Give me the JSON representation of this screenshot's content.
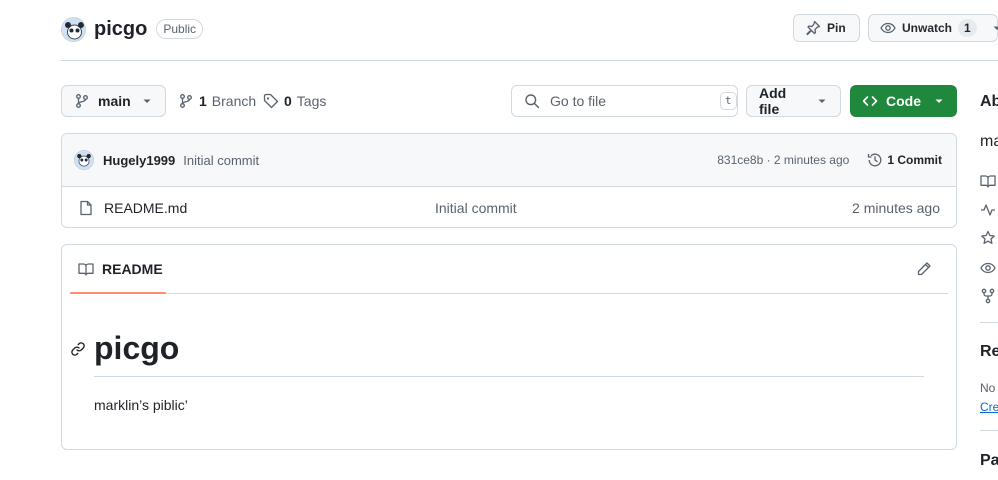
{
  "repo": {
    "name": "picgo",
    "visibility": "Public"
  },
  "header_actions": {
    "pin_label": "Pin",
    "unwatch_label": "Unwatch",
    "watch_count": "1"
  },
  "toolbar": {
    "branch": "main",
    "branches_count": "1",
    "branches_label": "Branch",
    "tags_count": "0",
    "tags_label": "Tags",
    "goto_placeholder": "Go to file",
    "goto_shortcut": "t",
    "add_file_label": "Add file",
    "code_label": "Code"
  },
  "latest_commit": {
    "author": "Hugely1999",
    "message": "Initial commit",
    "meta": "831ce8b · 2 minutes ago",
    "commit_count": "1 Commit"
  },
  "files": [
    {
      "name": "README.md",
      "commit": "Initial commit",
      "time": "2 minutes ago"
    }
  ],
  "readme": {
    "tab_label": "README",
    "heading": "picgo",
    "paragraph": "marklin’s piblic’"
  },
  "sidebar": {
    "about_heading": "Ab",
    "description": "ma",
    "releases_heading": "Re",
    "releases_text": "No",
    "releases_link": "Cre",
    "packages_heading": "Pa"
  },
  "colors": {
    "accent_green": "#1f883d",
    "tab_underline": "#fd8c73",
    "link": "#0969da"
  }
}
